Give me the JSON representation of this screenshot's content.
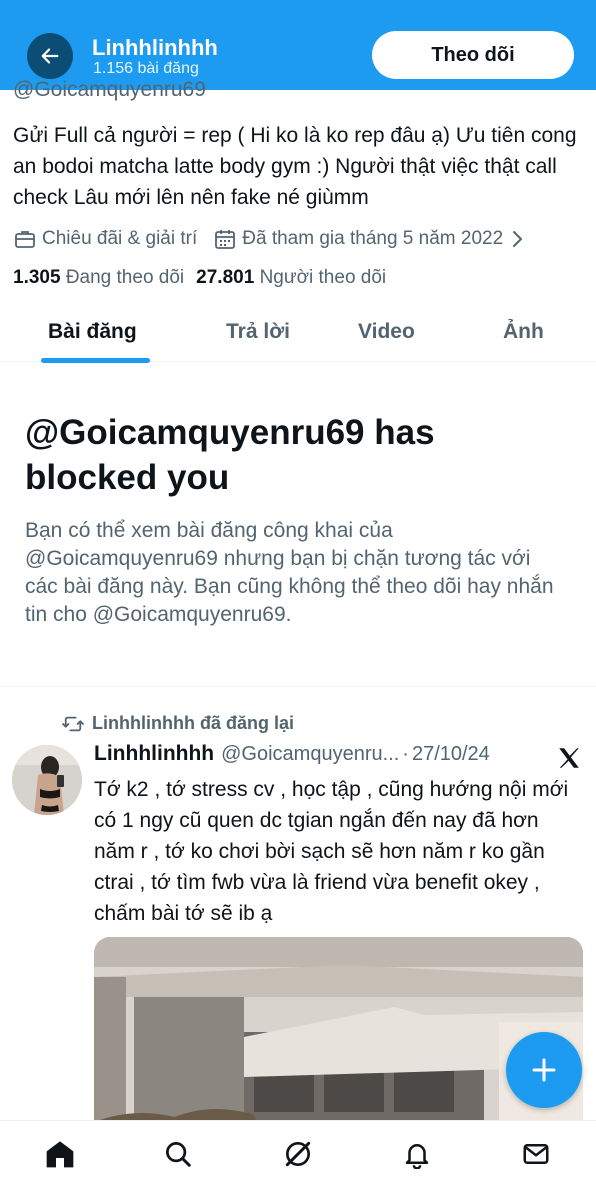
{
  "header": {
    "title": "Linhhlinhhh",
    "subtitle": "1.156 bài đăng",
    "follow_label": "Theo dõi",
    "back_icon": "arrow-left-icon",
    "bg_color": "#1d9bf0"
  },
  "profile": {
    "handle_peek": "@Goicamquyenru69",
    "bio": "Gửi Full cả người = rep ( Hi ko là ko rep đâu ạ) Ưu tiên cong an bodoi matcha latte body gym :) Người thật việc thật call check Lâu mới lên nên fake né giùmm",
    "category": "Chiêu đãi & giải trí",
    "joined": "Đã tham gia tháng 5 năm 2022",
    "following_count": "1.305",
    "following_label": "Đang theo dõi",
    "followers_count": "27.801",
    "followers_label": "Người theo dõi"
  },
  "tabs": [
    {
      "label": "Bài đăng",
      "active": true
    },
    {
      "label": "Trả lời",
      "active": false
    },
    {
      "label": "Video",
      "active": false
    },
    {
      "label": "Ảnh",
      "active": false
    }
  ],
  "blocked": {
    "title": "@Goicamquyenru69 has blocked you",
    "description": "Bạn có thể xem bài đăng công khai của @Goicamquyenru69 nhưng bạn bị chặn tương tác với các bài đăng này. Bạn cũng không thể theo dõi hay nhắn tin cho @Goicamquyenru69."
  },
  "tweet": {
    "repost_label": "Linhhlinhhh đã đăng lại",
    "author_name": "Linhhlinhhh",
    "author_handle": "@Goicamquyenru...",
    "separator": "·",
    "date": "27/10/24",
    "text": "Tớ k2 , tớ stress cv , học tập , cũng hướng nội mới có 1 ngy cũ quen dc tgian ngắn đến nay đã hơn năm r , tớ ko chơi bời sạch sẽ hơn năm r ko gần ctrai , tớ tìm fwb vừa là friend vừa benefit okey , chấm bài tớ sẽ ib ạ"
  },
  "fab_icon": "plus-icon",
  "bottom_nav": [
    "home-icon",
    "search-icon",
    "grok-icon",
    "bell-icon",
    "mail-icon"
  ]
}
